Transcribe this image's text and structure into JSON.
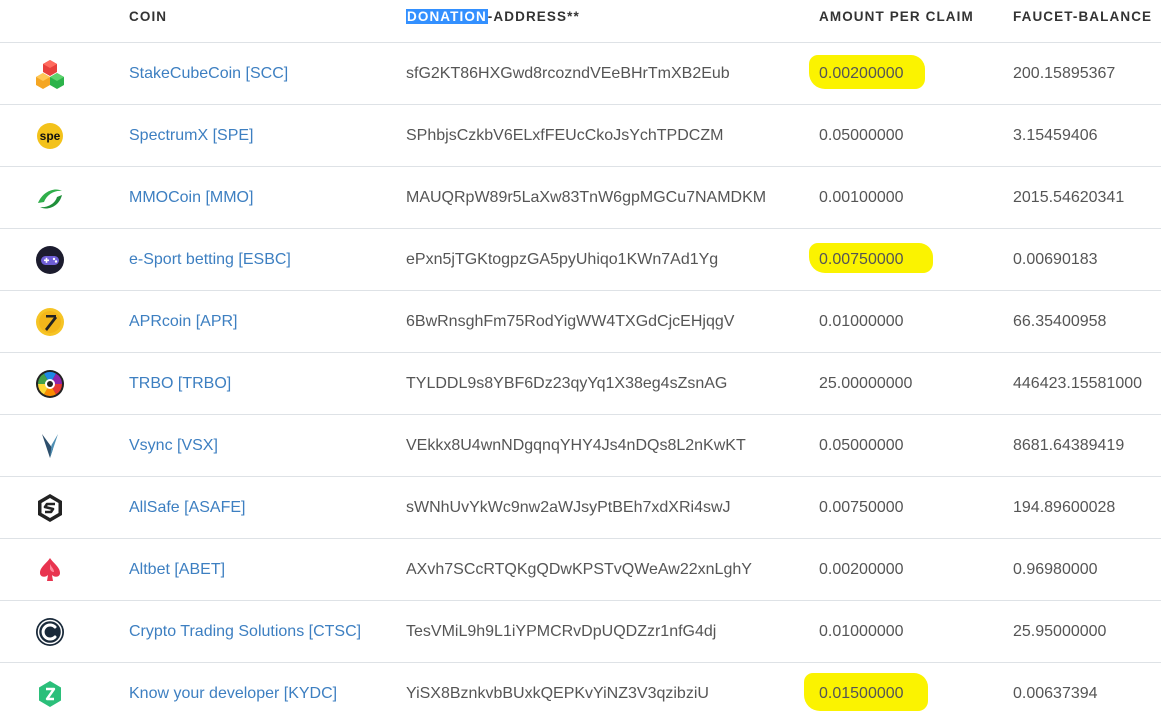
{
  "header": {
    "coin": "COIN",
    "address_selected": "DONATION",
    "address_rest": "-ADDRESS**",
    "amount": "AMOUNT PER CLAIM",
    "balance": "FAUCET-BALANCE"
  },
  "colors": {
    "link": "#3d7fc1",
    "highlight": "#fbf300",
    "selection": "#3390ff"
  },
  "rows": [
    {
      "name": "StakeCubeCoin [SCC]",
      "address": "sfG2KT86HXGwd8rcozndVEeBHrTmXB2Eub",
      "amount": "0.00200000",
      "balance": "200.15895367",
      "icon": "stakecube-cubes-icon",
      "highlighted": true
    },
    {
      "name": "SpectrumX [SPE]",
      "address": "SPhbjsCzkbV6ELxfFEUcCkoJsYchTPDCZM",
      "amount": "0.05000000",
      "balance": "3.15459406",
      "icon": "spe-badge-icon",
      "icon_text": "spe",
      "highlighted": false
    },
    {
      "name": "MMOCoin [MMO]",
      "address": "MAUQRpW89r5LaXw83TnW6gpMGCu7NAMDKM",
      "amount": "0.00100000",
      "balance": "2015.54620341",
      "icon": "mmo-swirl-icon",
      "highlighted": false
    },
    {
      "name": "e-Sport betting [ESBC]",
      "address": "ePxn5jTGKtogpzGA5pyUhiqo1KWn7Ad1Yg",
      "amount": "0.00750000",
      "balance": "0.00690183",
      "icon": "gamepad-icon",
      "highlighted": true
    },
    {
      "name": "APRcoin [APR]",
      "address": "6BwRnsghFm75RodYigWW4TXGdCjcEHjqgV",
      "amount": "0.01000000",
      "balance": "66.35400958",
      "icon": "apr-coin-icon",
      "highlighted": false
    },
    {
      "name": "TRBO [TRBO]",
      "address": "TYLDDL9s8YBF6Dz23qyYq1X38eg4sZsnAG",
      "amount": "25.00000000",
      "balance": "446423.15581000",
      "icon": "rainbow-aperture-icon",
      "highlighted": false
    },
    {
      "name": "Vsync [VSX]",
      "address": "VEkkx8U4wnNDgqnqYHY4Js4nDQs8L2nKwKT",
      "amount": "0.05000000",
      "balance": "8681.64389419",
      "icon": "vsync-v-icon",
      "highlighted": false
    },
    {
      "name": "AllSafe [ASAFE]",
      "address": "sWNhUvYkWc9nw2aWJsyPtBEh7xdXRi4swJ",
      "amount": "0.00750000",
      "balance": "194.89600028",
      "icon": "allsafe-hexagon-icon",
      "highlighted": false
    },
    {
      "name": "Altbet [ABET]",
      "address": "AXvh7SCcRTQKgQDwKPSTvQWeAw22xnLghY",
      "amount": "0.00200000",
      "balance": "0.96980000",
      "icon": "altbet-spade-icon",
      "highlighted": false
    },
    {
      "name": "Crypto Trading Solutions [CTSC]",
      "address": "TesVMiL9h9L1iYPMCRvDpUQDZzr1nfG4dj",
      "amount": "0.01000000",
      "balance": "25.95000000",
      "icon": "ctsc-c-icon",
      "highlighted": false
    },
    {
      "name": "Know your developer [KYDC]",
      "address": "YiSX8BznkvbBUxkQEPKvYiNZ3V3qzibziU",
      "amount": "0.01500000",
      "balance": "0.00637394",
      "icon": "kydc-hexagon-icon",
      "highlighted": true
    }
  ]
}
